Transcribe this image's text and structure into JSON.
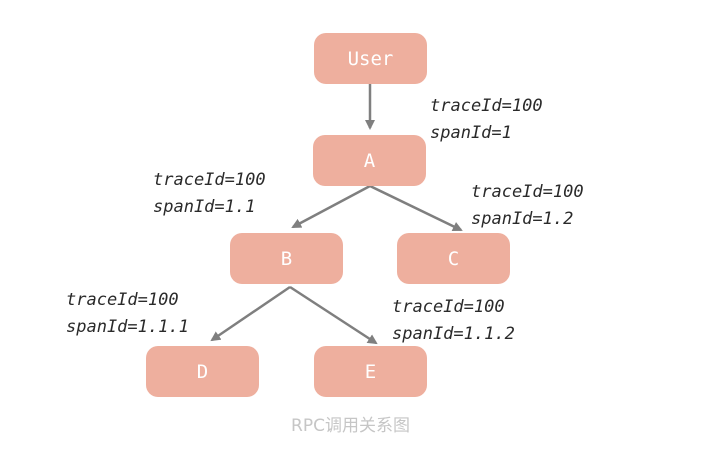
{
  "nodes": {
    "user": "User",
    "a": "A",
    "b": "B",
    "c": "C",
    "d": "D",
    "e": "E"
  },
  "labels": {
    "a": {
      "trace": "traceId=100",
      "span": "spanId=1"
    },
    "b": {
      "trace": "traceId=100",
      "span": "spanId=1.1"
    },
    "c": {
      "trace": "traceId=100",
      "span": "spanId=1.2"
    },
    "d": {
      "trace": "traceId=100",
      "span": "spanId=1.1.1"
    },
    "e": {
      "trace": "traceId=100",
      "span": "spanId=1.1.2"
    }
  },
  "caption": "RPC调用关系图",
  "colors": {
    "node_fill": "#eeaf9e",
    "arrow": "#7f7f7f",
    "caption": "#c6c6c6"
  }
}
